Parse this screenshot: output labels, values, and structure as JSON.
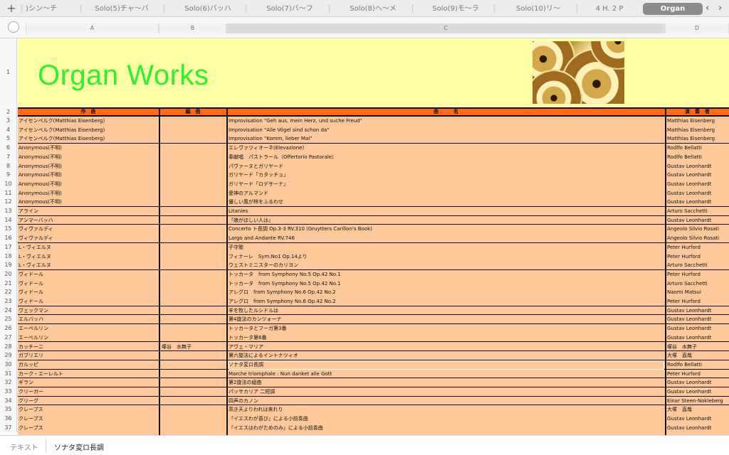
{
  "tabs": [
    {
      "label": ")シン〜チ"
    },
    {
      "label": "Solo(5)チャ〜バ"
    },
    {
      "label": "Solo(6)バッハ"
    },
    {
      "label": "Solo(7)バ〜フ"
    },
    {
      "label": "Solo(8)ヘ〜メ"
    },
    {
      "label": "Solo(9)モ〜ラ"
    },
    {
      "label": "Solo(10)リ〜"
    },
    {
      "label": "4 H. 2 P"
    },
    {
      "label": "Organ"
    }
  ],
  "add_tab_symbol": "+",
  "nav_arrows": {
    "prev": "‹",
    "next": "›"
  },
  "columns": [
    "A",
    "B",
    "C",
    "D"
  ],
  "title": "Organ Works",
  "headers": {
    "composer": "作　曲",
    "arranger": "編　曲",
    "piece": "曲　　　名",
    "performer": "演　奏　者"
  },
  "rows": [
    {
      "n": "3",
      "composer": "アイセンベルク(Matthias Eisenberg)",
      "arranger": "",
      "piece": "Improvisation \"Geh aus, mein Herz, und suche Freud\"",
      "performer": "Matthias Eisenberg"
    },
    {
      "n": "4",
      "composer": "アイセンベルク(Matthias Eisenberg)",
      "arranger": "",
      "piece": "Improvisation \"Alle Vögel sind schon da\"",
      "performer": "Matthias Eisenberg"
    },
    {
      "n": "5",
      "composer": "アイセンベルク(Matthias Eisenberg)",
      "arranger": "",
      "piece": "Improvisation \"Komm, lieber Mai\"",
      "performer": "Matthias Eisenberg",
      "end": true
    },
    {
      "n": "6",
      "composer": "Anonymous(不明)",
      "arranger": "",
      "piece": "エレヴァツィオーネ(Elevazione)",
      "performer": "Rodlfo Bellatti"
    },
    {
      "n": "7",
      "composer": "Anonymous(不明)",
      "arranger": "",
      "piece": "奉献唱　パストラール（Offertorio Pastorale）",
      "performer": "Rodlfo Bellatti"
    },
    {
      "n": "8",
      "composer": "Anonymous(不明)",
      "arranger": "",
      "piece": "パヴァーヌとガリヤード",
      "performer": "Gustav Leonhardt"
    },
    {
      "n": "9",
      "composer": "Anonymous(不明)",
      "arranger": "",
      "piece": "ガリヤード「カタッチョ」",
      "performer": "Gustav Leonhardt"
    },
    {
      "n": "10",
      "composer": "Anonymous(不明)",
      "arranger": "",
      "piece": "ガリヤード「ロデサーナ」",
      "performer": "Gustav Leonhardt"
    },
    {
      "n": "11",
      "composer": "Anonymous(不明)",
      "arranger": "",
      "piece": "愛神のアルマンド",
      "performer": "Gustav Leonhardt"
    },
    {
      "n": "12",
      "composer": "Anonymous(不明)",
      "arranger": "",
      "piece": "優しい風が林をふるわせ",
      "performer": "Gustav Leonhardt",
      "end": true
    },
    {
      "n": "13",
      "composer": "アライン",
      "arranger": "",
      "piece": "Litanies",
      "performer": "Arturo Sacchetti",
      "end": true
    },
    {
      "n": "14",
      "composer": "アンマーバッハ",
      "arranger": "",
      "piece": "『娘がほしい人は』",
      "performer": "Gustav Leonhardt",
      "end": true
    },
    {
      "n": "15",
      "composer": "ヴィヴァルディ",
      "arranger": "",
      "piece": "Concerto ト長調 Op.3-3 RV.310 (Gruytters Carillon's Book)",
      "performer": "Angeolo Silvio Rosati"
    },
    {
      "n": "16",
      "composer": "ヴィヴァルディ",
      "arranger": "",
      "piece": "Largo and Andante RV.746",
      "performer": "Angeolo Silvio Rosati",
      "end": true
    },
    {
      "n": "17",
      "composer": "L・ヴィエルヌ",
      "arranger": "",
      "piece": "子守歌",
      "performer": "Peter Hurford"
    },
    {
      "n": "18",
      "composer": "L・ヴィエルヌ",
      "arranger": "",
      "piece": "フィナーレ　Sym.No1 Op.14より",
      "performer": "Peter Hurford"
    },
    {
      "n": "19",
      "composer": "L・ヴィエルヌ",
      "arranger": "",
      "piece": "ウェストミニスターのカリヨン",
      "performer": "Arturo Sacchetti",
      "end": true
    },
    {
      "n": "20",
      "composer": "ヴィドール",
      "arranger": "",
      "piece": "トッカータ　from Symphony No.5 Op.42 No.1",
      "performer": "Peter Hurford"
    },
    {
      "n": "21",
      "composer": "ヴィドール",
      "arranger": "",
      "piece": "トッカータ　from Symphony No.5 Op.42 No.1",
      "performer": "Arturo Sacchetti"
    },
    {
      "n": "22",
      "composer": "ヴィドール",
      "arranger": "",
      "piece": "アレグロ　from Symphony No.6 Op.42 No.2",
      "performer": "Naomi Matsui"
    },
    {
      "n": "23",
      "composer": "ヴィドール",
      "arranger": "",
      "piece": "アレグロ　from Symphony No.6 Op.42 No.2",
      "performer": "Peter Hurford",
      "end": true
    },
    {
      "n": "24",
      "composer": "ヴェックマン",
      "arranger": "",
      "piece": "羊を牧したルシドルは",
      "performer": "Gustav Leonhardt",
      "end": true
    },
    {
      "n": "25",
      "composer": "エルバッハ",
      "arranger": "",
      "piece": "第4旋法のカンツォーナ",
      "performer": "Gustav Leonhardt",
      "end": true
    },
    {
      "n": "26",
      "composer": "エーベルリン",
      "arranger": "",
      "piece": "トッカータとフーガ第3番",
      "performer": "Gustav Leonhardt"
    },
    {
      "n": "27",
      "composer": "エーベルリン",
      "arranger": "",
      "piece": "トッカータ第6番",
      "performer": "Gustav Leonhardt",
      "end": true
    },
    {
      "n": "28",
      "composer": "カッチーニ",
      "arranger": "塚谷　水無子",
      "piece": "アヴェ・マリア",
      "performer": "塚谷　水無子",
      "end": true
    },
    {
      "n": "29",
      "composer": "ガブリエリ",
      "arranger": "",
      "piece": "第六旋法によるイントナツィオ",
      "performer": "大塚　直哉",
      "end": true
    },
    {
      "n": "30",
      "composer": "ガルッピ",
      "arranger": "",
      "piece": "ソナタ変ロ長調",
      "performer": "Rodlfo Bellatti",
      "end": true,
      "selected": true
    },
    {
      "n": "31",
      "composer": "カーク・エーレルト",
      "arranger": "",
      "piece": "Marche triomphale : Nun danket alle Gott",
      "performer": "Peter Hurford",
      "end": true
    },
    {
      "n": "32",
      "composer": "ギラン",
      "arranger": "",
      "piece": "第2旋法の組曲",
      "performer": "Gustav Leonhardt",
      "end": true
    },
    {
      "n": "33",
      "composer": "クリーガー",
      "arranger": "",
      "piece": "パッサカリア 二短調",
      "performer": "Gustav Leonhardt",
      "end": true
    },
    {
      "n": "34",
      "composer": "グリーグ",
      "arranger": "",
      "piece": "四声のカノン",
      "performer": "Einar Steen-Nokleberg",
      "end": true
    },
    {
      "n": "35",
      "composer": "クレープス",
      "arranger": "",
      "piece": "高き天よりわれは来れり",
      "performer": "大塚　直哉"
    },
    {
      "n": "36",
      "composer": "クレープス",
      "arranger": "",
      "piece": "『イエスわが喜び』による小前奏曲",
      "performer": "Gustav Leonhardt"
    },
    {
      "n": "37",
      "composer": "クレープス",
      "arranger": "",
      "piece": "『イエスはわがためのみ』による小前奏曲",
      "performer": "Gustav Leonhardt"
    }
  ],
  "bottom_bar": {
    "label": "テキスト",
    "value": "ソナタ変ロ長調"
  },
  "colors": {
    "title_bg": "#ffffa6",
    "title_text": "#2cf22c",
    "header_bg": "#ff6a1a",
    "data_bg": "#ffc89a",
    "active_tab": "#8c8c8c"
  }
}
